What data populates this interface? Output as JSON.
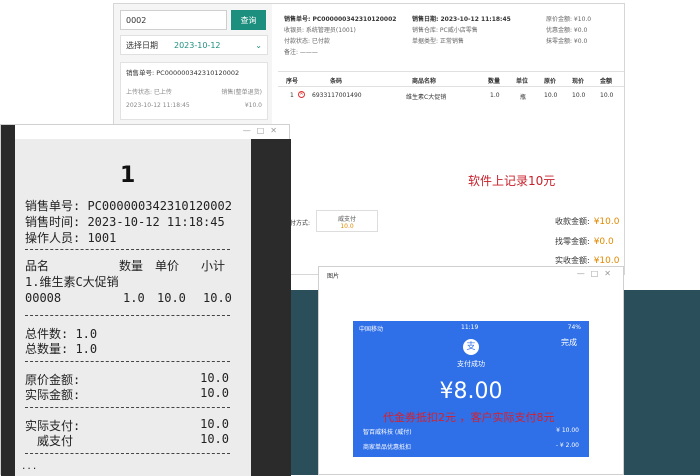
{
  "pos": {
    "search_value": "0002",
    "search_button": "查询",
    "date_label": "选择日期",
    "date_value": "2023-10-12",
    "order_card": {
      "order_no": "销售单号: PC000000342310120002",
      "upload_status": "上传状态: 已上传",
      "type": "销售(整单退货)",
      "time": "2023-10-12 11:18:45",
      "amount": "¥10.0"
    },
    "info": {
      "order_no": "销售单号: PC000000342310120002",
      "cashier": "收银员: 系统管理员(1001)",
      "pay_status": "付款状态: 已付款",
      "remark": "备注: ———",
      "sale_date": "销售日期: 2023-10-12 11:18:45",
      "warehouse": "销售仓库: PC威小店零售",
      "doc_type": "单据类型: 正常销售",
      "orig_amount": "原价金额: ¥10.0",
      "discount_amount": "优惠金额: ¥0.0",
      "wipe_amount": "抹零金额: ¥0.0"
    },
    "columns": [
      "序号",
      "条码",
      "商品名称",
      "数量",
      "单位",
      "原价",
      "现价",
      "金额"
    ],
    "rows": [
      [
        "1",
        "6933117001490",
        "维生素C大促销",
        "1.0",
        "瓶",
        "10.0",
        "10.0",
        "10.0"
      ]
    ],
    "annotation": "软件上记录10元",
    "pay_method_label": "支付方式:",
    "pay_method_name": "威支付",
    "pay_method_amount": "10.0",
    "summary": {
      "received_label": "收款金额:",
      "received_value": "¥10.0",
      "change_label": "找零金额:",
      "change_value": "¥0.0",
      "actual_label": "实收金额:",
      "actual_value": "¥10.0"
    }
  },
  "receipt": {
    "number": "1",
    "order_no": "销售单号: PC000000342310120002",
    "sale_time": "销售时间: 2023-10-12 11:18:45",
    "operator": "操作人员: 1001",
    "col_name": "品名",
    "col_qty": "数量",
    "col_price": "单价",
    "col_subtotal": "小计",
    "item_name": "1.维生素C大促销",
    "item_code": "00008",
    "item_qty": "1.0",
    "item_price": "10.0",
    "item_subtotal": "10.0",
    "total_pieces": "总件数: 1.0",
    "total_qty": "总数量: 1.0",
    "orig_amount_label": "原价金额:",
    "orig_amount_value": "10.0",
    "actual_amount_label": "实际金额:",
    "actual_amount_value": "10.0",
    "actual_pay_label": "实际支付:",
    "actual_pay_value": "10.0",
    "wei_pay_label": "威支付",
    "wei_pay_value": "10.0",
    "dots": "..."
  },
  "image_window": {
    "title": "图片",
    "carrier": "中国移动",
    "time": "11:19",
    "battery": "74%",
    "done": "完成",
    "logo": "支",
    "success": "支付成功",
    "amount": "¥8.00",
    "note": "代金券抵扣2元 ，客户实际支付8元",
    "merchant": "智百威科技 (威付)",
    "merchant_amount": "¥ 10.00",
    "coupon": "商家单品优惠抵扣",
    "coupon_amount": "- ¥ 2.00"
  },
  "window_controls": "—□✕"
}
